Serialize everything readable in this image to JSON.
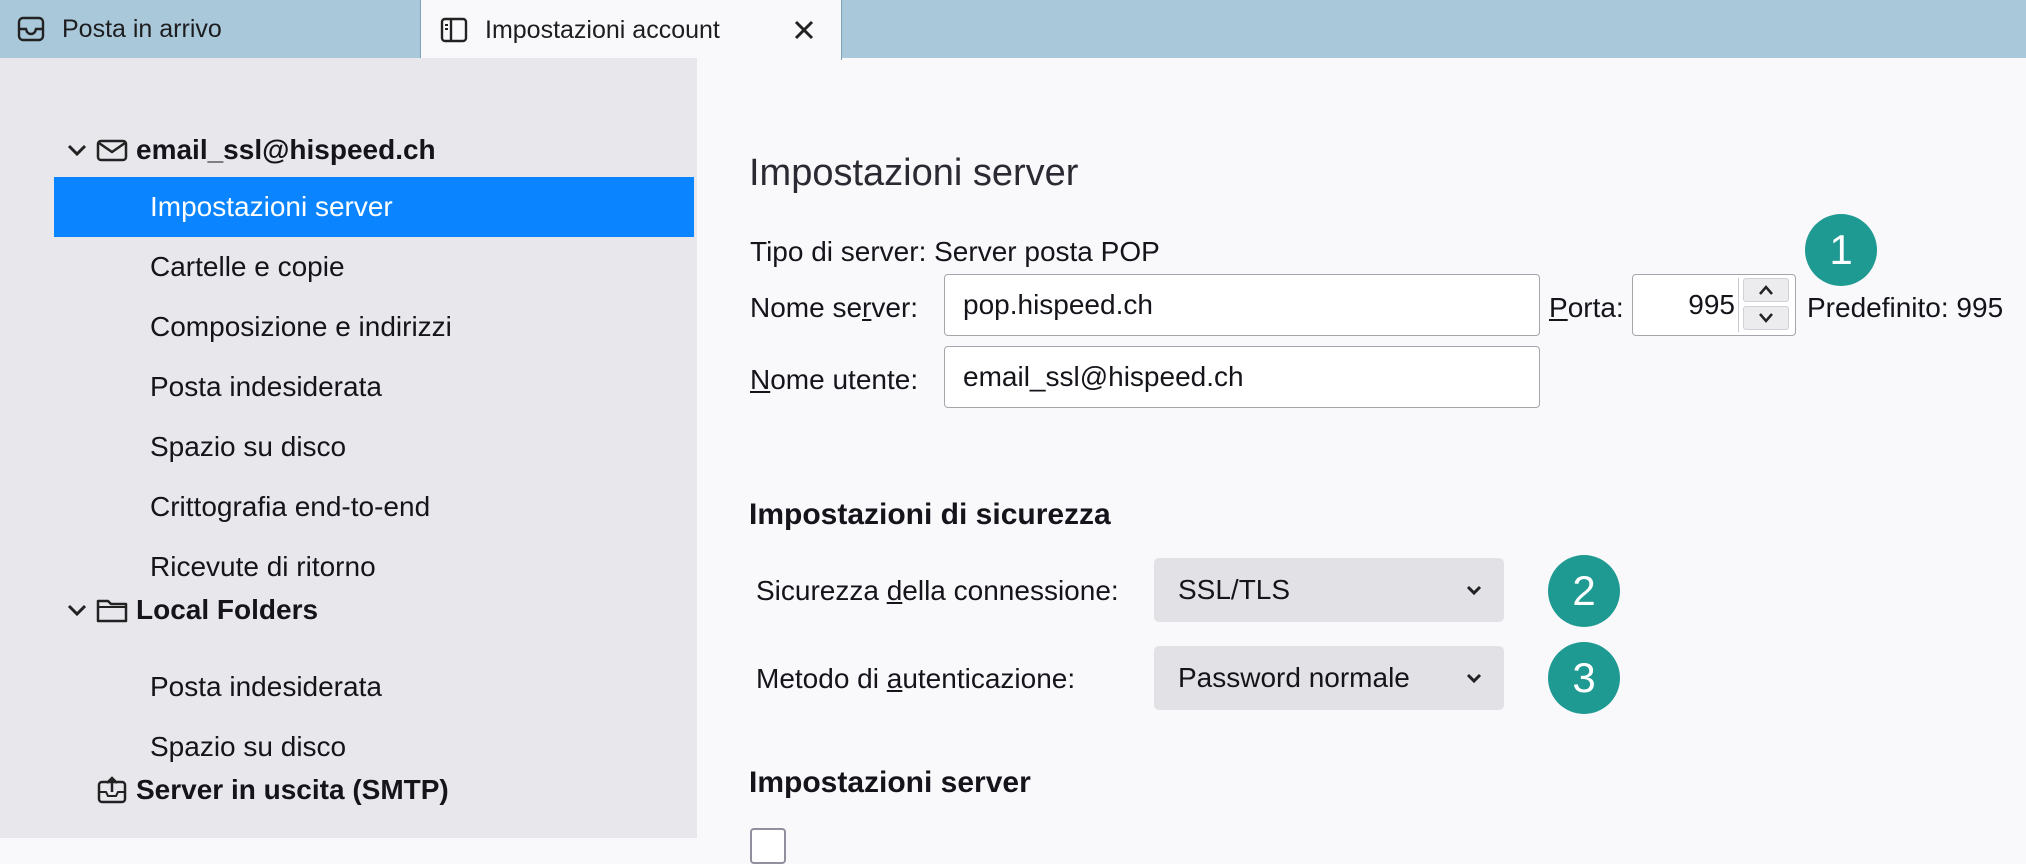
{
  "tabs": {
    "inbox_label": "Posta in arrivo",
    "active_label": "Impostazioni account",
    "close_symbol": "✕"
  },
  "sidebar": {
    "account_name": "email_ssl@hispeed.ch",
    "account_items": [
      "Impostazioni server",
      "Cartelle e copie",
      "Composizione e indirizzi",
      "Posta indesiderata",
      "Spazio su disco",
      "Crittografia end-to-end",
      "Ricevute di ritorno"
    ],
    "local_folders_name": "Local Folders",
    "local_items": [
      "Posta indesiderata",
      "Spazio su disco"
    ],
    "smtp_label": "Server in uscita (SMTP)",
    "selected_color": "#0a84ff"
  },
  "main": {
    "title": "Impostazioni server",
    "server_type": "Tipo di server: Server posta POP",
    "server_name_label_pre": "Nome se",
    "server_name_label_u": "r",
    "server_name_label_post": "ver:",
    "server_name_value": "pop.hispeed.ch",
    "port_label_u": "P",
    "port_label_post": "orta:",
    "port_value": "995",
    "port_default": "Predefinito: 995",
    "username_label_u": "N",
    "username_label_post": "ome utente:",
    "username_value": "email_ssl@hispeed.ch",
    "security_heading": "Impostazioni di sicurezza",
    "conn_security_label_pre": "Sicurezza ",
    "conn_security_label_u": "d",
    "conn_security_label_post": "ella connessione:",
    "conn_security_value": "SSL/TLS",
    "auth_label_pre": "Metodo di ",
    "auth_label_u": "a",
    "auth_label_post": "utenticazione:",
    "auth_value": "Password normale",
    "server_heading2": "Impostazioni server",
    "badges": [
      "1",
      "2",
      "3"
    ],
    "badge_color": "#1f9a92"
  }
}
